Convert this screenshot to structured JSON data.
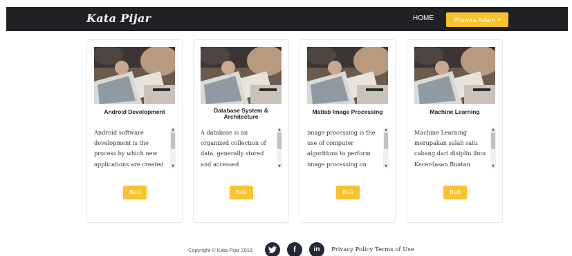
{
  "navbar": {
    "brand": "Kata Pijar",
    "home_label": "HOME",
    "user_label": "Prawira Adam",
    "user_caret_icon": "caret-down-icon",
    "background": "#202124",
    "accent": "#f9c22e"
  },
  "courses": [
    {
      "title": "Android Development",
      "description": "Android software development is the process by which new applications are created",
      "button_label": "Beli",
      "image_icon": "course-photo"
    },
    {
      "title": "Database System & Architecture",
      "description": "A database is an organized collection of data, generally stored and accessed electronically",
      "button_label": "Beli",
      "image_icon": "course-photo"
    },
    {
      "title": "Matlab Image Processing",
      "description": "image processing is the use of computer algorithms to perform image processing on",
      "button_label": "Beli",
      "image_icon": "course-photo"
    },
    {
      "title": "Machine Learning",
      "description": "Machine Learning merupakan salah satu cabang dari disiplin ilmu Kecerdasan Buatan",
      "button_label": "Beli",
      "image_icon": "course-photo"
    }
  ],
  "footer": {
    "copyright": "Copyright © Kata Pijar 2019",
    "social": [
      {
        "name": "twitter-icon",
        "glyph": "🐦"
      },
      {
        "name": "facebook-icon",
        "glyph": "f"
      },
      {
        "name": "linkedin-icon",
        "glyph": "in"
      }
    ],
    "privacy_label": "Privacy Policy",
    "terms_label": "Terms of Use"
  }
}
